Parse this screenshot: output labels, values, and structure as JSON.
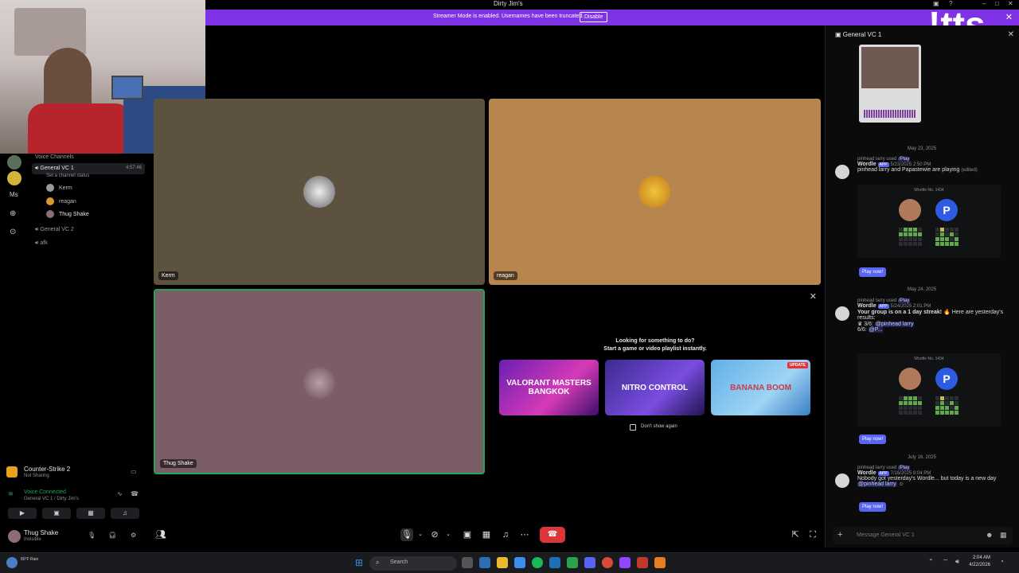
{
  "window": {
    "title": "Dirty Jim's",
    "overlay_text": "!tts"
  },
  "banner": {
    "message": "Streamer Mode is enabled. Usernames have been truncated.",
    "disable_label": "Disable",
    "bg": "#7f32e6"
  },
  "sidebar": {
    "section_label": "Voice Channels",
    "channels": [
      {
        "name": "General VC 1",
        "status": "Set a channel status",
        "timer": "4:57:46",
        "active": true
      },
      {
        "name": "General VC 2",
        "active": false
      },
      {
        "name": "afk",
        "active": false
      }
    ],
    "members": [
      "Kerm",
      "reagan",
      "Thug Shake"
    ],
    "server_label": "Ms"
  },
  "activity": {
    "game": "Counter-Strike 2",
    "sub": "Not Sharing"
  },
  "voice": {
    "status": "Voice Connected",
    "location": "General VC 1 / Dirty Jim's",
    "status_color": "#23a55a"
  },
  "user": {
    "name": "Thug Shake",
    "status": "Invisible"
  },
  "tiles": [
    {
      "name": "Kerm",
      "bg": "#5d5140"
    },
    {
      "name": "reagan",
      "bg": "#b7864f"
    },
    {
      "name": "Thug Shake",
      "bg": "#7b5d66"
    }
  ],
  "activities": {
    "headline": "Looking for something to do?",
    "subline": "Start a game or video playlist instantly.",
    "cards": [
      {
        "label": "VALORANT MASTERS BANGKOK",
        "badge": ""
      },
      {
        "label": "NITRO CONTROL",
        "badge": ""
      },
      {
        "label": "BANANA BOOM",
        "badge": "UPDATE"
      }
    ],
    "dont_show": "Don't show again"
  },
  "chat": {
    "channel": "General VC 1",
    "input_placeholder": "Message General VC 1",
    "messages": [
      {
        "date": "May 23, 2025",
        "used_by": "pinhead larry",
        "used": "used",
        "cmd": "/Play",
        "author": "Wordle",
        "app": "APP",
        "time": "5/23/2025 2:50 PM",
        "text": "pinhead larry and Papastewie are playing",
        "edited": "(edited)",
        "card_title": "Wordle No. 1434",
        "button": "Play now!"
      },
      {
        "date": "May 24, 2025",
        "used_by": "pinhead larry",
        "used": "used",
        "cmd": "/Play",
        "author": "Wordle",
        "app": "APP",
        "time": "5/24/2025 2:01 PM",
        "text_bold": "Your group is on a 1 day streak!",
        "text_rest": "Here are yesterday's results:",
        "r1": "3/6:",
        "r1_user": "@pinhead larry",
        "r2": "6/6:",
        "r2_user": "@P...",
        "card_title": "Wordle No. 1434",
        "button": "Play now!"
      },
      {
        "date": "July 16, 2025",
        "used_by": "pinhead larry",
        "used": "used",
        "cmd": "/Play",
        "author": "Wordle",
        "app": "APP",
        "time": "7/16/2025 8:04 PM",
        "text": "Nobody got yesterday's Wordle... but today is a new day",
        "mention": "@pinhead larry",
        "button": "Play now!"
      }
    ]
  },
  "taskbar": {
    "search": "Search",
    "weather": "80°F Rain",
    "time": "2:04 AM",
    "date": "4/22/2026"
  }
}
